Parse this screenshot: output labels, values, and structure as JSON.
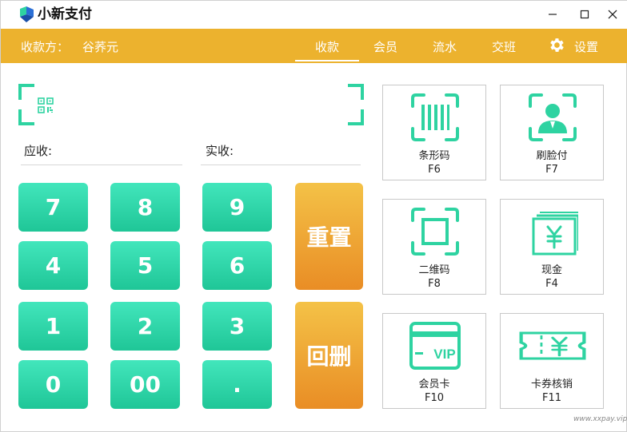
{
  "window": {
    "title": "小新支付",
    "minimize_icon": "minimize-icon",
    "maximize_icon": "maximize-icon",
    "close_icon": "close-icon"
  },
  "navbar": {
    "payee_label": "收款方：",
    "payee_value": "谷荞元",
    "tabs": [
      {
        "label": "收款",
        "active": true
      },
      {
        "label": "会员",
        "active": false
      },
      {
        "label": "流水",
        "active": false
      },
      {
        "label": "交班",
        "active": false
      }
    ],
    "settings_label": "设置",
    "settings_icon": "gear-icon"
  },
  "scan": {
    "icon": "qr-code-icon",
    "accent_color": "#2ed3a1"
  },
  "fields": {
    "due_label": "应收:",
    "received_label": "实收:"
  },
  "keypad": {
    "keys": [
      "7",
      "8",
      "9",
      "4",
      "5",
      "6",
      "1",
      "2",
      "3",
      "0",
      "00",
      "."
    ],
    "reset_label": "重置",
    "delete_label": "回删",
    "key_color": "#2fd6a8",
    "action_color": "#ecaa33"
  },
  "payment_methods": [
    {
      "name": "条形码",
      "key": "F6",
      "icon": "barcode-icon"
    },
    {
      "name": "刷脸付",
      "key": "F7",
      "icon": "face-pay-icon"
    },
    {
      "name": "二维码",
      "key": "F8",
      "icon": "qr-scan-icon"
    },
    {
      "name": "现金",
      "key": "F4",
      "icon": "cash-icon"
    },
    {
      "name": "会员卡",
      "key": "F10",
      "icon": "vip-card-icon",
      "icon_text": "VIP"
    },
    {
      "name": "卡券核销",
      "key": "F11",
      "icon": "coupon-icon"
    }
  ],
  "watermark": "www.xxpay.vip",
  "colors": {
    "brand_orange": "#ecb22e",
    "green": "#2ed3a1"
  }
}
